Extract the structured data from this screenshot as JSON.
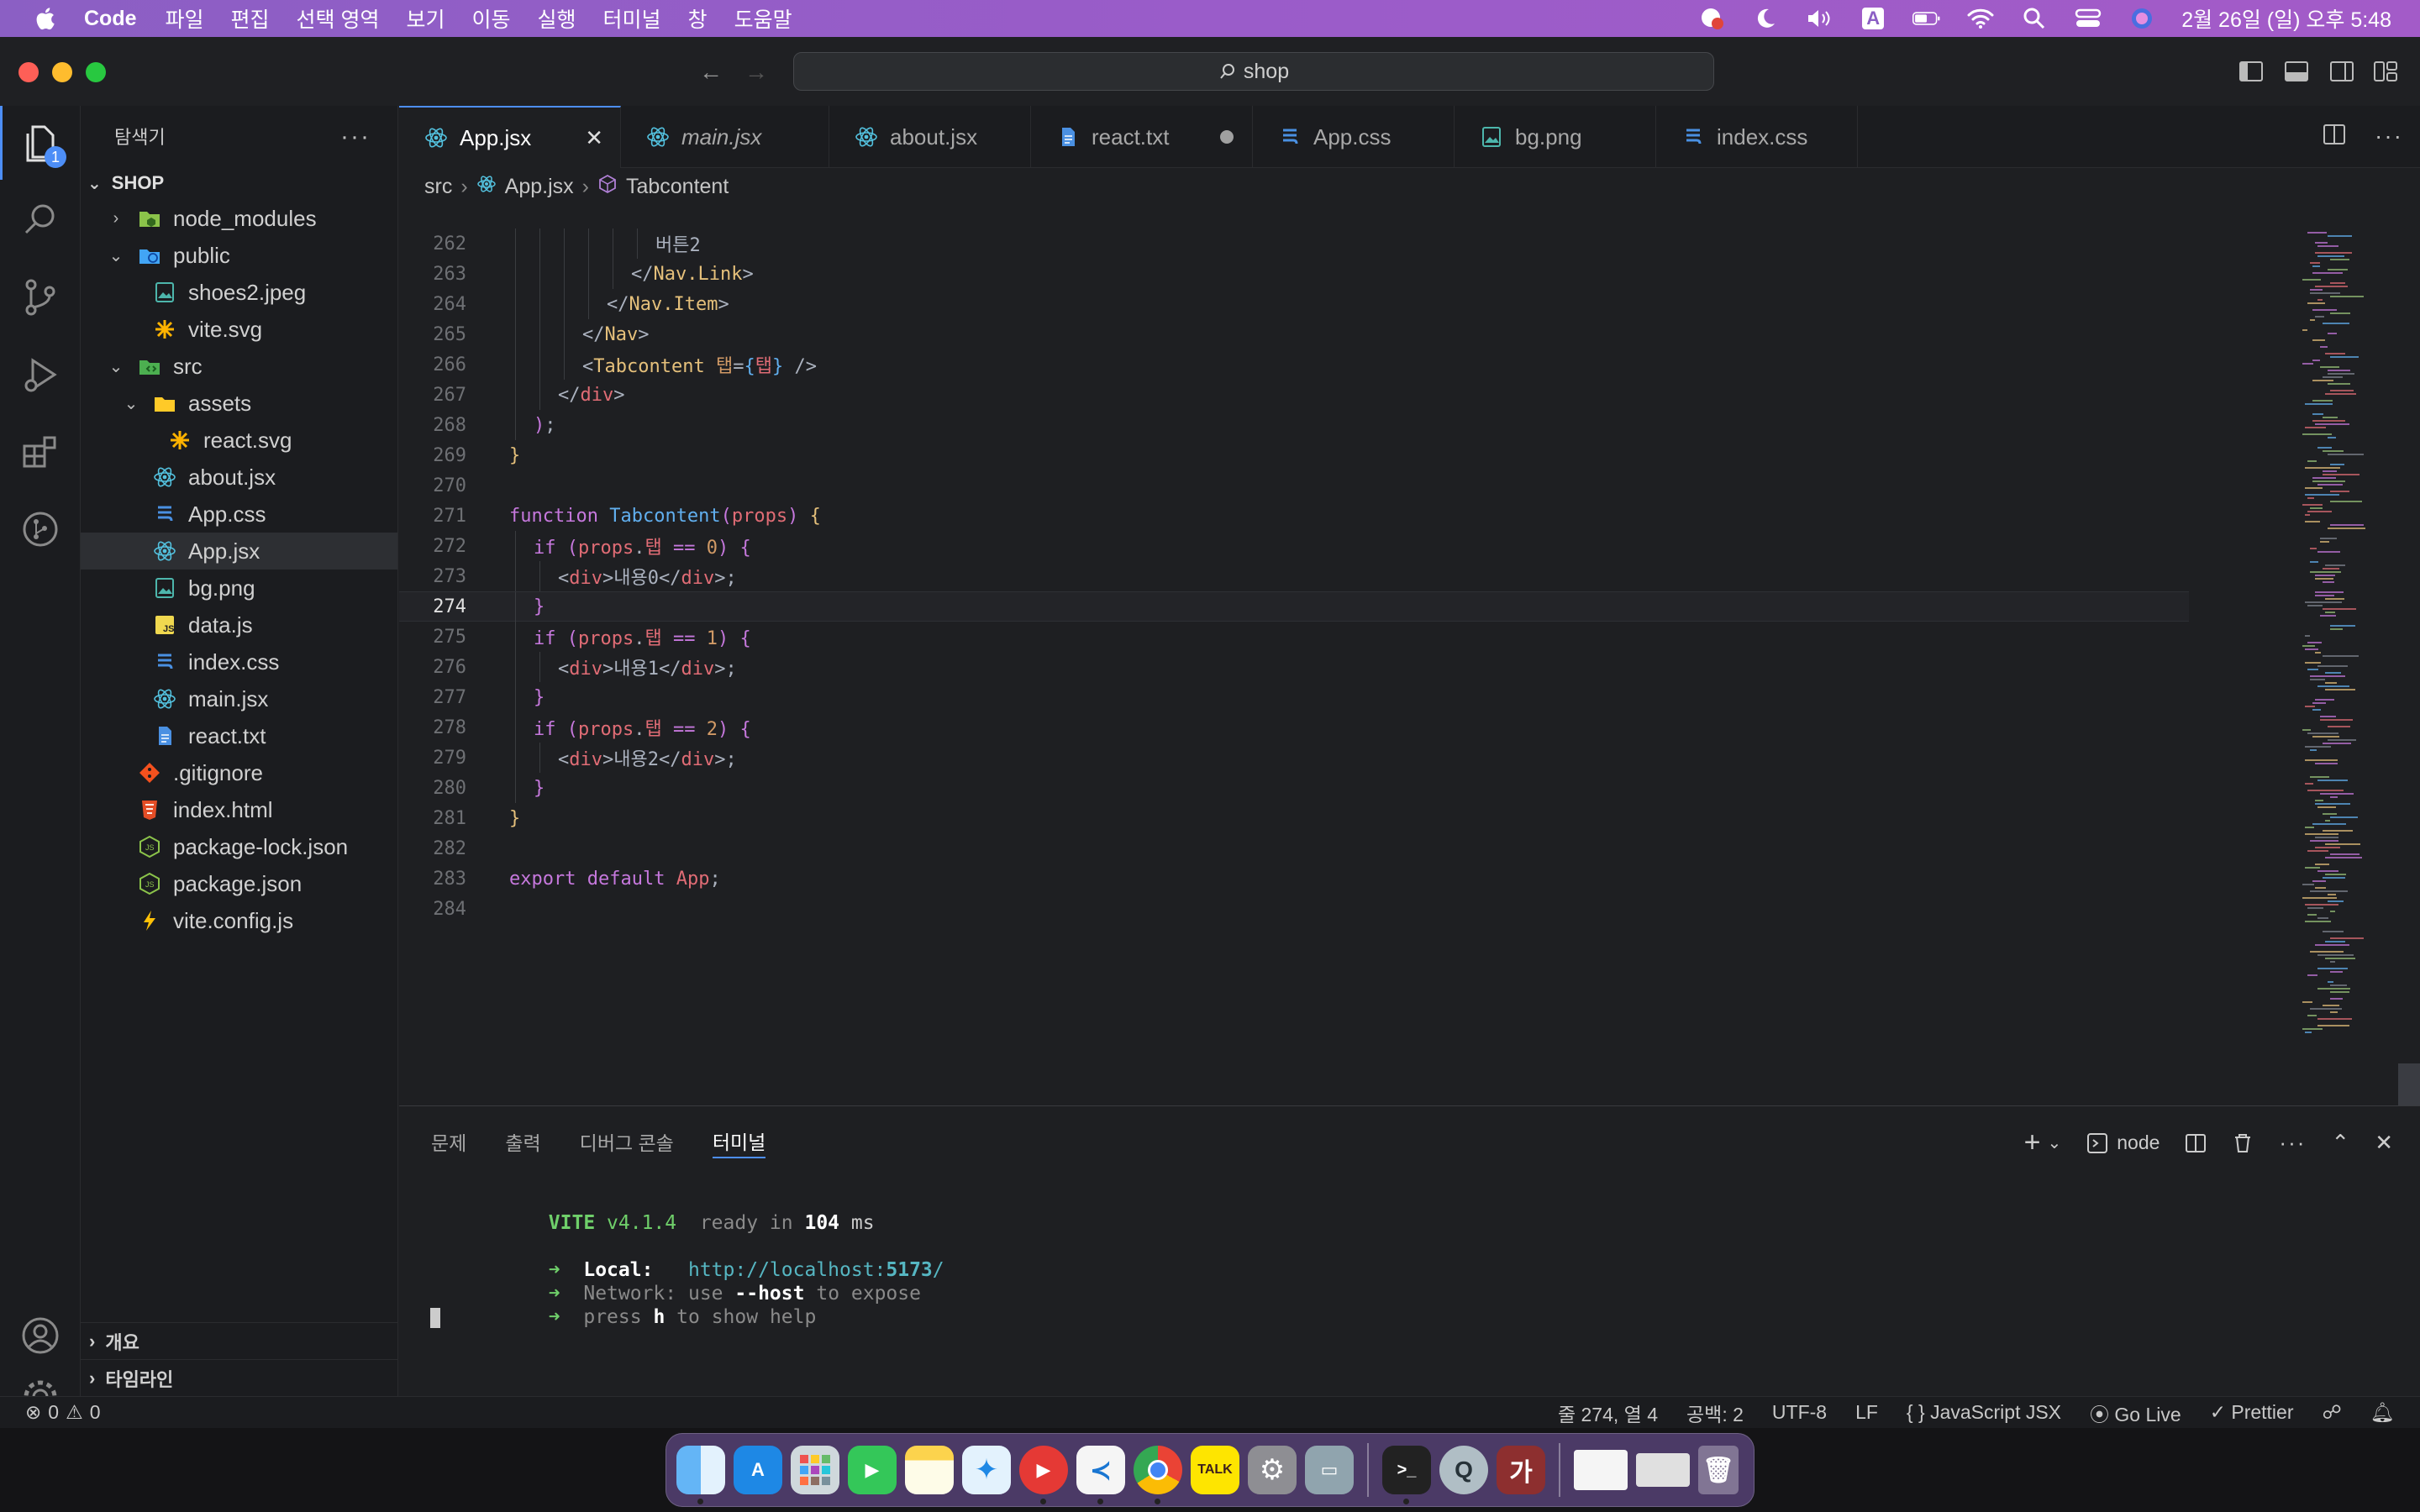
{
  "menubar": {
    "app_name": "Code",
    "items": [
      "파일",
      "편집",
      "선택 영역",
      "보기",
      "이동",
      "실행",
      "터미널",
      "창",
      "도움말"
    ],
    "status_icons": [
      "bell-badge-icon",
      "moon-icon",
      "volume-icon",
      "input-source-icon",
      "battery-icon",
      "wifi-icon",
      "spotlight-icon",
      "control-center-icon",
      "siri-icon"
    ],
    "input_source": "A",
    "clock": "2월 26일 (일) 오후 5:48"
  },
  "titlebar": {
    "search_text": "shop"
  },
  "activity_bar": {
    "explorer_badge": "1"
  },
  "sidebar": {
    "title": "탐색기",
    "more": "···",
    "section": "SHOP",
    "tree": [
      {
        "label": "node_modules",
        "depth": 0,
        "kind": "folder",
        "chev": "›",
        "icon": "folder-node"
      },
      {
        "label": "public",
        "depth": 0,
        "kind": "folder-open",
        "chev": "⌄",
        "icon": "folder-public"
      },
      {
        "label": "shoes2.jpeg",
        "depth": 1,
        "kind": "file",
        "icon": "image"
      },
      {
        "label": "vite.svg",
        "depth": 1,
        "kind": "file",
        "icon": "svg"
      },
      {
        "label": "src",
        "depth": 0,
        "kind": "folder-open",
        "chev": "⌄",
        "icon": "folder-src"
      },
      {
        "label": "assets",
        "depth": 1,
        "kind": "folder-open",
        "chev": "⌄",
        "icon": "folder-assets"
      },
      {
        "label": "react.svg",
        "depth": 2,
        "kind": "file",
        "icon": "svg"
      },
      {
        "label": "about.jsx",
        "depth": 1,
        "kind": "file",
        "icon": "react"
      },
      {
        "label": "App.css",
        "depth": 1,
        "kind": "file",
        "icon": "css"
      },
      {
        "label": "App.jsx",
        "depth": 1,
        "kind": "file",
        "icon": "react",
        "selected": true
      },
      {
        "label": "bg.png",
        "depth": 1,
        "kind": "file",
        "icon": "image"
      },
      {
        "label": "data.js",
        "depth": 1,
        "kind": "file",
        "icon": "js"
      },
      {
        "label": "index.css",
        "depth": 1,
        "kind": "file",
        "icon": "css"
      },
      {
        "label": "main.jsx",
        "depth": 1,
        "kind": "file",
        "icon": "react"
      },
      {
        "label": "react.txt",
        "depth": 1,
        "kind": "file",
        "icon": "txt"
      },
      {
        "label": ".gitignore",
        "depth": 0,
        "kind": "file",
        "icon": "git"
      },
      {
        "label": "index.html",
        "depth": 0,
        "kind": "file",
        "icon": "html"
      },
      {
        "label": "package-lock.json",
        "depth": 0,
        "kind": "file",
        "icon": "node"
      },
      {
        "label": "package.json",
        "depth": 0,
        "kind": "file",
        "icon": "node"
      },
      {
        "label": "vite.config.js",
        "depth": 0,
        "kind": "file",
        "icon": "vite"
      }
    ],
    "outline_label": "개요",
    "timeline_label": "타임라인"
  },
  "editor": {
    "tabs": [
      {
        "label": "App.jsx",
        "icon": "react",
        "active": true,
        "close": "✕"
      },
      {
        "label": "main.jsx",
        "icon": "react",
        "italic": true
      },
      {
        "label": "about.jsx",
        "icon": "react"
      },
      {
        "label": "react.txt",
        "icon": "txt",
        "dirty": true
      },
      {
        "label": "App.css",
        "icon": "css"
      },
      {
        "label": "bg.png",
        "icon": "image"
      },
      {
        "label": "index.css",
        "icon": "css"
      }
    ],
    "breadcrumb": [
      "src",
      "App.jsx",
      "Tabcontent"
    ],
    "current_line": 274,
    "lines": [
      {
        "num": "262",
        "indent": 6,
        "tokens": [
          [
            "p",
            "버튼2"
          ]
        ]
      },
      {
        "num": "263",
        "indent": 5,
        "tokens": [
          [
            "p",
            "</"
          ],
          [
            "v",
            "Nav.Link"
          ],
          [
            "p",
            ">"
          ]
        ]
      },
      {
        "num": "264",
        "indent": 4,
        "tokens": [
          [
            "p",
            "</"
          ],
          [
            "v",
            "Nav.Item"
          ],
          [
            "p",
            ">"
          ]
        ]
      },
      {
        "num": "265",
        "indent": 3,
        "tokens": [
          [
            "p",
            "</"
          ],
          [
            "v",
            "Nav"
          ],
          [
            "p",
            ">"
          ]
        ]
      },
      {
        "num": "266",
        "indent": 3,
        "tokens": [
          [
            "p",
            "<"
          ],
          [
            "v",
            "Tabcontent"
          ],
          [
            "p",
            " "
          ],
          [
            "n",
            "탭"
          ],
          [
            "p",
            "="
          ],
          [
            "b",
            "{"
          ],
          [
            "t",
            "탭"
          ],
          [
            "b",
            "}"
          ],
          [
            "p",
            " />"
          ]
        ]
      },
      {
        "num": "267",
        "indent": 2,
        "tokens": [
          [
            "p",
            "</"
          ],
          [
            "t",
            "div"
          ],
          [
            "p",
            ">"
          ]
        ]
      },
      {
        "num": "268",
        "indent": 1,
        "tokens": [
          [
            "k",
            ")"
          ],
          [
            "p",
            ";"
          ]
        ]
      },
      {
        "num": "269",
        "indent": 0,
        "tokens": [
          [
            "y",
            "}"
          ]
        ]
      },
      {
        "num": "270",
        "indent": 0,
        "tokens": []
      },
      {
        "num": "271",
        "indent": 0,
        "tokens": [
          [
            "k",
            "function"
          ],
          [
            "p",
            " "
          ],
          [
            "f",
            "Tabcontent"
          ],
          [
            "k",
            "("
          ],
          [
            "t",
            "props"
          ],
          [
            "k",
            ")"
          ],
          [
            "p",
            " "
          ],
          [
            "y",
            "{"
          ]
        ]
      },
      {
        "num": "272",
        "indent": 1,
        "tokens": [
          [
            "k",
            "if"
          ],
          [
            "p",
            " "
          ],
          [
            "k",
            "("
          ],
          [
            "t",
            "props"
          ],
          [
            "p",
            "."
          ],
          [
            "t",
            "탭"
          ],
          [
            "p",
            " "
          ],
          [
            "k",
            "=="
          ],
          [
            "p",
            " "
          ],
          [
            "n",
            "0"
          ],
          [
            "k",
            ")"
          ],
          [
            "p",
            " "
          ],
          [
            "k",
            "{"
          ]
        ]
      },
      {
        "num": "273",
        "indent": 2,
        "tokens": [
          [
            "p",
            "<"
          ],
          [
            "t",
            "div"
          ],
          [
            "p",
            ">내용0</"
          ],
          [
            "t",
            "div"
          ],
          [
            "p",
            ">;"
          ]
        ]
      },
      {
        "num": "274",
        "indent": 1,
        "tokens": [
          [
            "k",
            "}"
          ]
        ]
      },
      {
        "num": "275",
        "indent": 1,
        "tokens": [
          [
            "k",
            "if"
          ],
          [
            "p",
            " "
          ],
          [
            "k",
            "("
          ],
          [
            "t",
            "props"
          ],
          [
            "p",
            "."
          ],
          [
            "t",
            "탭"
          ],
          [
            "p",
            " "
          ],
          [
            "k",
            "=="
          ],
          [
            "p",
            " "
          ],
          [
            "n",
            "1"
          ],
          [
            "k",
            ")"
          ],
          [
            "p",
            " "
          ],
          [
            "k",
            "{"
          ]
        ]
      },
      {
        "num": "276",
        "indent": 2,
        "tokens": [
          [
            "p",
            "<"
          ],
          [
            "t",
            "div"
          ],
          [
            "p",
            ">내용1</"
          ],
          [
            "t",
            "div"
          ],
          [
            "p",
            ">;"
          ]
        ]
      },
      {
        "num": "277",
        "indent": 1,
        "tokens": [
          [
            "k",
            "}"
          ]
        ]
      },
      {
        "num": "278",
        "indent": 1,
        "tokens": [
          [
            "k",
            "if"
          ],
          [
            "p",
            " "
          ],
          [
            "k",
            "("
          ],
          [
            "t",
            "props"
          ],
          [
            "p",
            "."
          ],
          [
            "t",
            "탭"
          ],
          [
            "p",
            " "
          ],
          [
            "k",
            "=="
          ],
          [
            "p",
            " "
          ],
          [
            "n",
            "2"
          ],
          [
            "k",
            ")"
          ],
          [
            "p",
            " "
          ],
          [
            "k",
            "{"
          ]
        ]
      },
      {
        "num": "279",
        "indent": 2,
        "tokens": [
          [
            "p",
            "<"
          ],
          [
            "t",
            "div"
          ],
          [
            "p",
            ">내용2</"
          ],
          [
            "t",
            "div"
          ],
          [
            "p",
            ">;"
          ]
        ]
      },
      {
        "num": "280",
        "indent": 1,
        "tokens": [
          [
            "k",
            "}"
          ]
        ]
      },
      {
        "num": "281",
        "indent": 0,
        "tokens": [
          [
            "y",
            "}"
          ]
        ]
      },
      {
        "num": "282",
        "indent": 0,
        "tokens": []
      },
      {
        "num": "283",
        "indent": 0,
        "tokens": [
          [
            "k",
            "export"
          ],
          [
            "p",
            " "
          ],
          [
            "k",
            "default"
          ],
          [
            "p",
            " "
          ],
          [
            "t",
            "App"
          ],
          [
            "p",
            ";"
          ]
        ]
      },
      {
        "num": "284",
        "indent": 0,
        "tokens": []
      }
    ]
  },
  "panel": {
    "tabs": [
      "문제",
      "출력",
      "디버그 콘솔",
      "터미널"
    ],
    "active_tab": "터미널",
    "terminal_profile": "node",
    "terminal": {
      "vite_label": "VITE",
      "vite_version": "v4.1.4",
      "ready_text": "ready in",
      "ready_ms": "104",
      "ms": "ms",
      "arrow": "➜",
      "local_label": "Local:",
      "local_url_prefix": "http://localhost:",
      "local_port": "5173",
      "local_url_suffix": "/",
      "network_label": "Network:",
      "network_use": "use",
      "network_flag": "--host",
      "network_rest": "to expose",
      "help_prefix": "press",
      "help_key": "h",
      "help_rest": "to show help"
    }
  },
  "statusbar": {
    "errors": "0",
    "warnings": "0",
    "position": "줄 274, 열 4",
    "spaces": "공백: 2",
    "encoding": "UTF-8",
    "eol": "LF",
    "language": "JavaScript JSX",
    "golive": "Go Live",
    "prettier": "Prettier"
  },
  "dock": {
    "apps": [
      "finder",
      "app-store",
      "launchpad",
      "facetime",
      "notes",
      "safari",
      "youtube",
      "vscode",
      "chrome",
      "kakaotalk",
      "system-settings",
      "remote-desktop",
      "terminal",
      "quicktime",
      "dictionary",
      "window-thumb-1",
      "window-thumb-2",
      "trash"
    ],
    "talk_label": "TALK",
    "dict_label": "가"
  },
  "colors": {
    "menubar": "#9a5cc9",
    "accent": "#4d8ef7",
    "editor_bg": "#1e1f22",
    "sidebar_bg": "#1b1c1f"
  }
}
